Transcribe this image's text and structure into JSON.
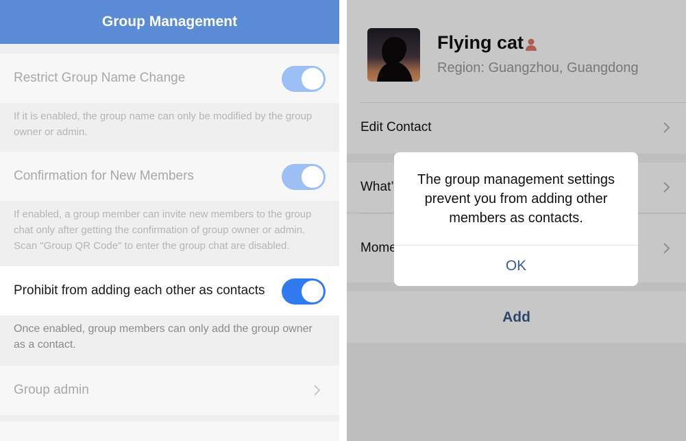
{
  "left": {
    "header_title": "Group Management",
    "settings": [
      {
        "label": "Restrict Group Name Change",
        "enabled": true,
        "description": "If it is enabled, the group name can only be modified by the group owner or admin."
      },
      {
        "label": "Confirmation for New Members",
        "enabled": true,
        "description": "If enabled, a group member can invite new members to the group chat only after getting the confirmation of group owner or admin. Scan \"Group QR Code\" to enter the group chat are disabled."
      },
      {
        "label": "Prohibit from adding each other as contacts",
        "enabled": true,
        "description": "Once enabled, group members can only add the group owner as a contact."
      }
    ],
    "group_admin_label": "Group admin",
    "toggle_color_active": "#2f7bed",
    "toggle_color_dimmed": "#9cc0f4",
    "header_color": "#5a8bd4"
  },
  "right": {
    "profile": {
      "name": "Flying cat",
      "region": "Region: Guangzhou, Guangdong"
    },
    "rows": {
      "edit_contact": "Edit Contact",
      "whats_up_partial": "What’",
      "moments_partial": "Mome"
    },
    "add_label": "Add",
    "dialog": {
      "message": "The group management settings prevent you from adding other members as contacts.",
      "ok_label": "OK"
    },
    "accent_color": "#3c5a8a"
  }
}
